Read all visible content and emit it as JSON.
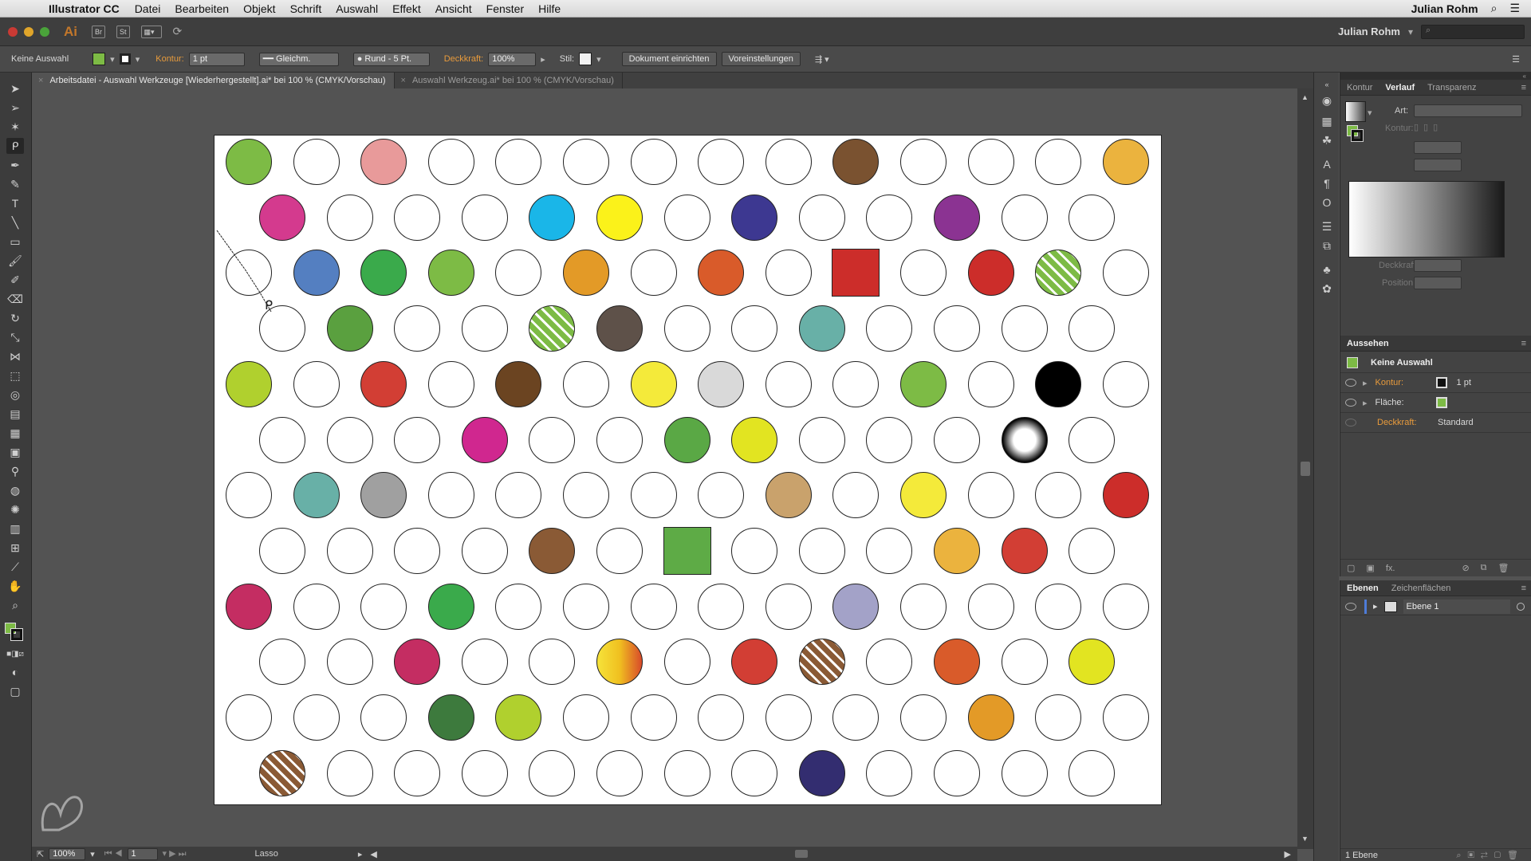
{
  "menubar": {
    "app_name": "Illustrator CC",
    "items": [
      "Datei",
      "Bearbeiten",
      "Objekt",
      "Schrift",
      "Auswahl",
      "Effekt",
      "Ansicht",
      "Fenster",
      "Hilfe"
    ],
    "user": "Julian Rohm"
  },
  "appbar": {
    "logo": "Ai",
    "bridge": "Br",
    "stock": "St",
    "workspace_user": "Julian Rohm",
    "search_placeholder": "⌕"
  },
  "control_bar": {
    "selection_state": "Keine Auswahl",
    "fill_color": "#7dbb45",
    "stroke_label": "Kontur:",
    "stroke_weight": "1 pt",
    "stroke_profile": "Gleichm.",
    "brush": "Rund - 5 Pt.",
    "opacity_label": "Deckkraft:",
    "opacity_value": "100%",
    "style_label": "Stil:",
    "doc_setup_button": "Dokument einrichten",
    "preferences_button": "Voreinstellungen"
  },
  "doc_tabs": [
    {
      "label": "Arbeitsdatei - Auswahl Werkzeuge [Wiederhergestellt].ai* bei 100 % (CMYK/Vorschau)",
      "active": true
    },
    {
      "label": "Auswahl Werkzeug.ai* bei 100 % (CMYK/Vorschau)",
      "active": false
    }
  ],
  "status_bar": {
    "zoom": "100%",
    "artboard_number": "1",
    "current_tool": "Lasso"
  },
  "panel_gradient": {
    "tabs": [
      "Kontur",
      "Verlauf",
      "Transparenz"
    ],
    "active_tab": "Verlauf",
    "type_label": "Art:",
    "stroke_label": "Kontur:",
    "opacity_label": "Deckkraft:",
    "position_label": "Position:"
  },
  "panel_appearance": {
    "title": "Aussehen",
    "header": "Keine Auswahl",
    "stroke_label": "Kontur:",
    "stroke_value": "1 pt",
    "fill_label": "Fläche:",
    "opacity_label": "Deckkraft:",
    "opacity_value": "Standard",
    "fx_label": "fx."
  },
  "panel_layers": {
    "tabs": [
      "Ebenen",
      "Zeichenflächen"
    ],
    "layer_name": "Ebene 1",
    "footer": "1 Ebene"
  },
  "artwork": {
    "rows": [
      [
        "#7dbb45",
        "",
        "#e89a9a",
        "",
        "",
        "",
        "",
        "",
        "",
        "#7a5230",
        "",
        "",
        "",
        "#ebb33e"
      ],
      [
        "#d43a8e",
        "",
        "",
        "",
        "#1ab6e8",
        "#fbf21a",
        "",
        "#3d3891",
        "",
        "",
        "#8b3392",
        "",
        ""
      ],
      [
        "",
        "#547fc1",
        "#3aaa4b",
        "#7dbb45",
        "",
        "#e39a27",
        "",
        "#d95b2a",
        "",
        "SQ:#cc2d2a",
        "",
        "#cc2d2a",
        "PAT:#7dbb45",
        ""
      ],
      [
        "",
        "#5aa03f",
        "",
        "",
        "PAT:#7dbb45",
        "#5e5149",
        "",
        "",
        "#68b0a7",
        "",
        "",
        "",
        ""
      ],
      [
        "#b0d02e",
        "",
        "#d23e34",
        "",
        "#6b4421",
        "",
        "#f4ea3a",
        "#d9d9d9",
        "",
        "",
        "#7dbb45",
        "",
        "#000000",
        ""
      ],
      [
        "",
        "",
        "",
        "#d0278f",
        "",
        "",
        "#5aa845",
        "#e2e421",
        "",
        "",
        "",
        "RAD:#000000",
        ""
      ],
      [
        "",
        "#68b0a7",
        "#a0a0a0",
        "",
        "",
        "",
        "",
        "",
        "#c9a26c",
        "",
        "#f4ea3a",
        "",
        "",
        "#cc2d2a"
      ],
      [
        "",
        "",
        "",
        "",
        "#8a5a35",
        "",
        "SQ:#5eab46",
        "",
        "",
        "",
        "#ebb33e",
        "#d23e34",
        ""
      ],
      [
        "#c42d62",
        "",
        "",
        "#3aaa4b",
        "",
        "",
        "",
        "",
        "",
        "#a3a2c8",
        "",
        "",
        "",
        ""
      ],
      [
        "",
        "",
        "#c42d62",
        "",
        "",
        "GRD:#f0c020",
        "",
        "#d23e34",
        "PAT:#8a5a35",
        "",
        "#d95b2a",
        "",
        "#e2e421"
      ],
      [
        "",
        "",
        "",
        "#3d7a3d",
        "#b0d02e",
        "",
        "",
        "",
        "",
        "",
        "",
        "#e39a27",
        "",
        ""
      ],
      [
        "PAT:#8a5a35",
        "",
        "",
        "",
        "",
        "",
        "",
        "",
        "#332d70",
        "",
        "",
        "",
        ""
      ]
    ]
  }
}
